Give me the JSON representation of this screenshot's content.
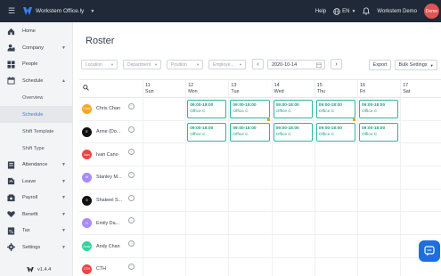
{
  "app": {
    "company_name": "Workstem Office.ly",
    "help_label": "Help",
    "language": "EN",
    "user_name": "Workstem Demo",
    "user_avatar_text": "Demo",
    "brand_color": "#1f2937",
    "accent_color": "#2bb5a3"
  },
  "sidebar": {
    "items": [
      {
        "label": "Home",
        "icon": "home-icon"
      },
      {
        "label": "Company",
        "icon": "company-icon"
      },
      {
        "label": "People",
        "icon": "grid-icon"
      },
      {
        "label": "Schedule",
        "icon": "calendar-icon"
      },
      {
        "label": "Attendance",
        "icon": "attendance-icon"
      },
      {
        "label": "Leave",
        "icon": "leave-icon"
      },
      {
        "label": "Payroll",
        "icon": "payroll-icon"
      },
      {
        "label": "Benefit",
        "icon": "benefit-icon"
      },
      {
        "label": "Tax",
        "icon": "tax-icon"
      },
      {
        "label": "Settings",
        "icon": "gear-icon"
      }
    ],
    "schedule_sub": [
      "Overview",
      "Schedule",
      "Shift Template",
      "Shift Type"
    ],
    "active_sub": "Schedule",
    "version": "v1.4.4"
  },
  "page": {
    "title": "Roster",
    "filters": {
      "location": "Location",
      "department": "Department",
      "position": "Position",
      "employee": "Employe..."
    },
    "date": "2020-10-14",
    "export_label": "Export",
    "bulk_label": "Bulk Settings"
  },
  "days": [
    {
      "num": "11",
      "name": "Sun"
    },
    {
      "num": "12",
      "name": "Mon"
    },
    {
      "num": "13",
      "name": "Tue"
    },
    {
      "num": "14",
      "name": "Wed"
    },
    {
      "num": "15",
      "name": "Thu"
    },
    {
      "num": "16",
      "name": "Fri"
    },
    {
      "num": "17",
      "name": "Sat"
    }
  ],
  "employees": [
    {
      "name": "Chris Chan",
      "initials": "Chris",
      "color": "#f5a623"
    },
    {
      "name": "Anne (Do...",
      "initials": "E",
      "color": "#111111"
    },
    {
      "name": "Ivan Cano",
      "initials": "Ivan",
      "color": "#ef4444"
    },
    {
      "name": "Stanley M...",
      "initials": "M",
      "color": "#a78bfa"
    },
    {
      "name": "Shakeel S...",
      "initials": "S",
      "color": "#111111"
    },
    {
      "name": "Emily Da...",
      "initials": "D",
      "color": "#a78bfa"
    },
    {
      "name": "Andy Chan",
      "initials": "Andy",
      "color": "#34d399"
    },
    {
      "name": "CTH",
      "initials": "CTH",
      "color": "#ef4444"
    }
  ],
  "shift": {
    "time": "09:00-18:00",
    "office": "Office C"
  }
}
